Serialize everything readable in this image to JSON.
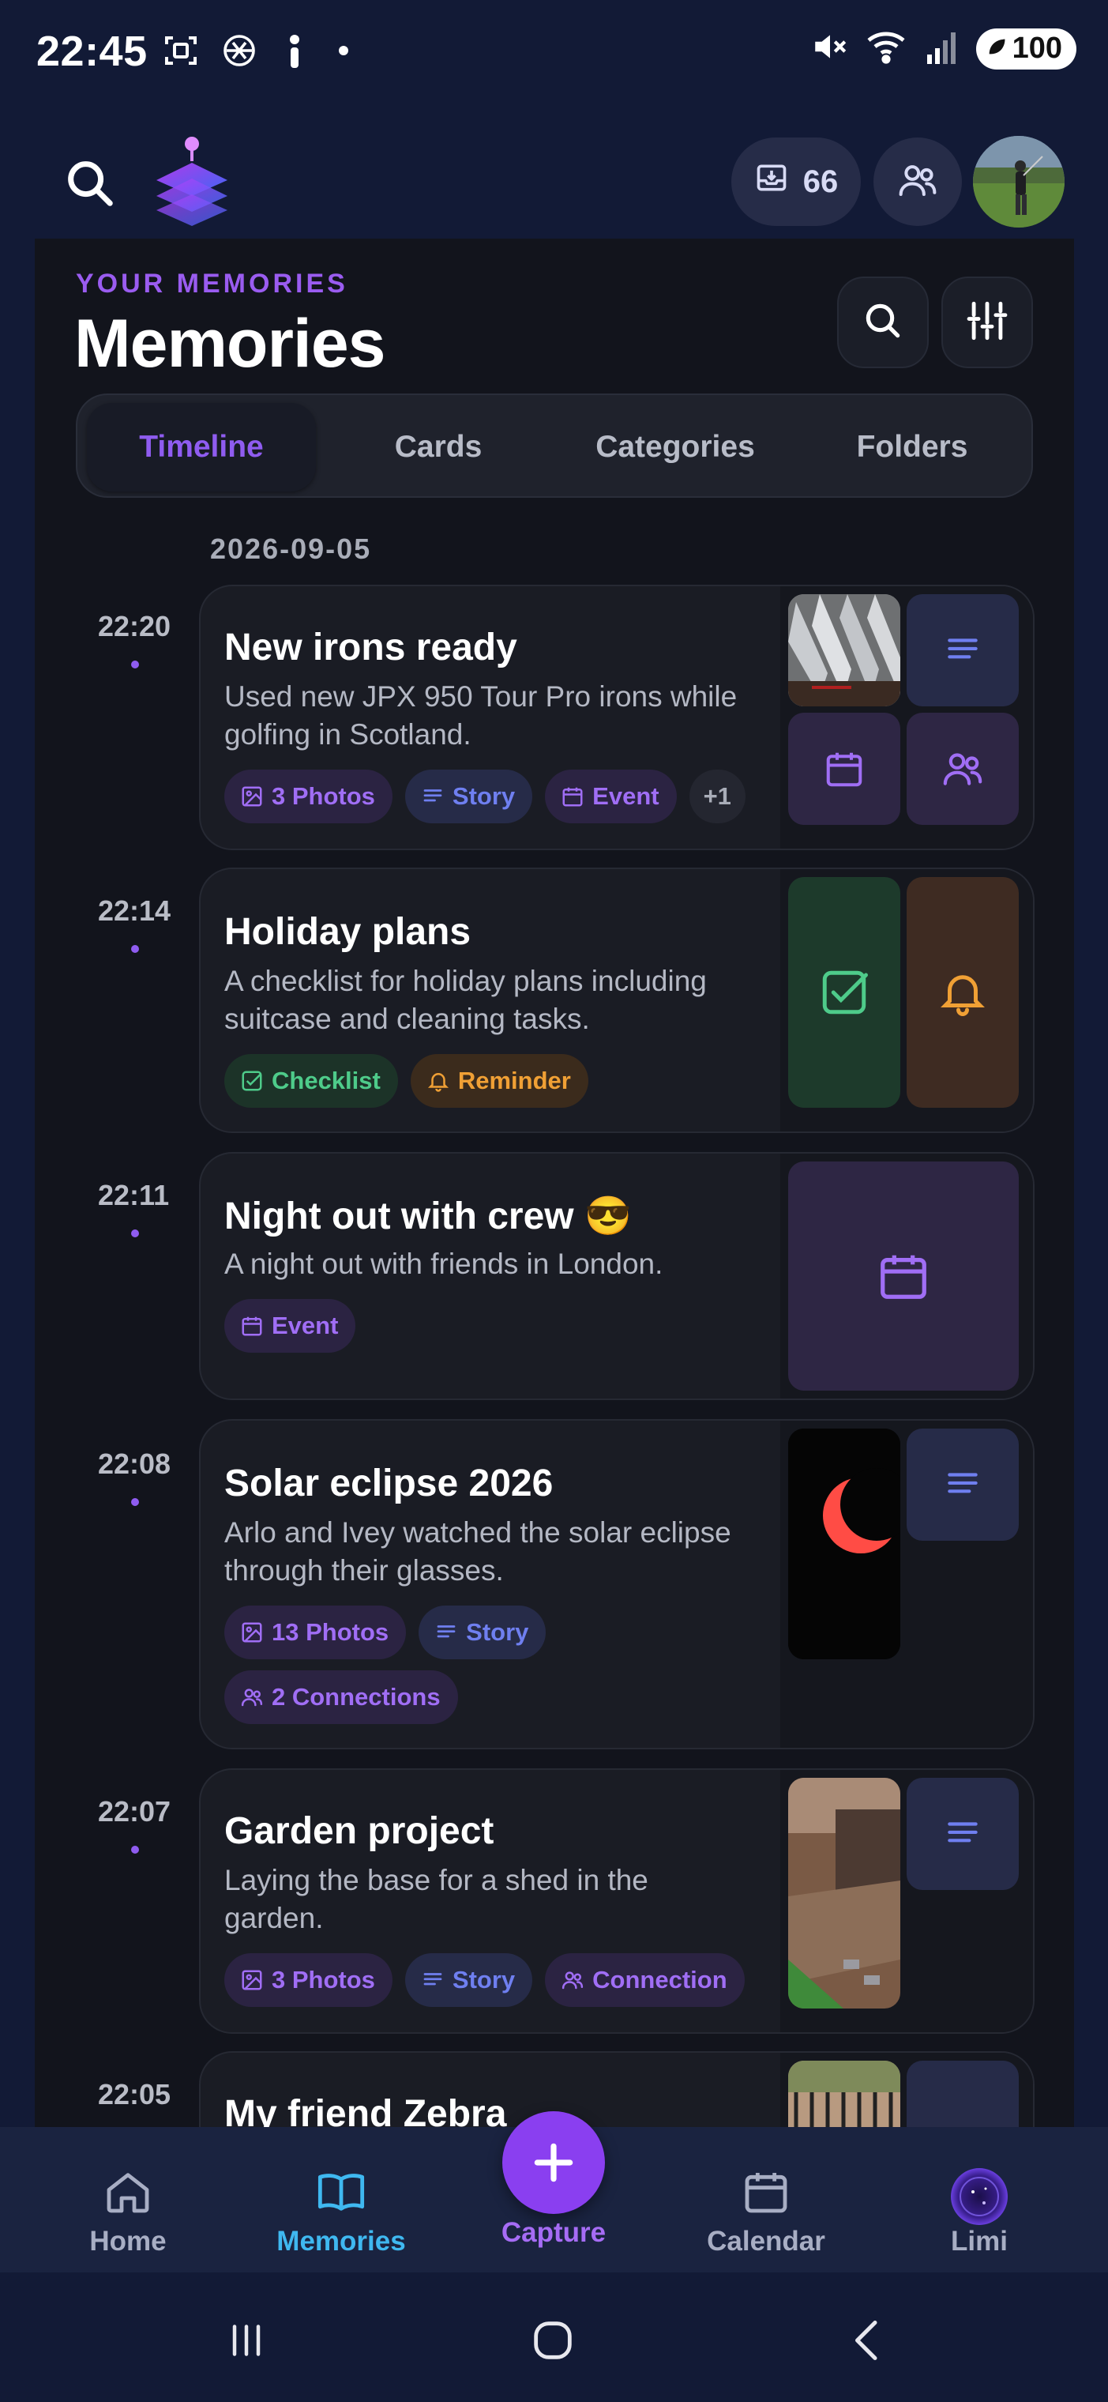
{
  "status_bar": {
    "time": "22:45",
    "battery": "100"
  },
  "header": {
    "archive_count": "66"
  },
  "page": {
    "eyebrow": "YOUR MEMORIES",
    "title": "Memories",
    "tabs": [
      {
        "label": "Timeline",
        "active": true
      },
      {
        "label": "Cards",
        "active": false
      },
      {
        "label": "Categories",
        "active": false
      },
      {
        "label": "Folders",
        "active": false
      }
    ]
  },
  "timeline": {
    "date": "2026-09-05",
    "entries": [
      {
        "time": "22:20",
        "title": "New irons ready",
        "description": "Used new JPX 950 Tour Pro irons while golfing in Scotland.",
        "chips": [
          {
            "label": "3 Photos",
            "icon": "image-icon"
          },
          {
            "label": "Story",
            "icon": "lines-icon"
          },
          {
            "label": "Event",
            "icon": "calendar-icon"
          },
          {
            "label": "+1",
            "icon": ""
          }
        ]
      },
      {
        "time": "22:14",
        "title": "Holiday plans",
        "description": "A checklist for holiday plans including suitcase and cleaning tasks.",
        "chips": [
          {
            "label": "Checklist",
            "icon": "checkbox-icon"
          },
          {
            "label": "Reminder",
            "icon": "bell-icon"
          }
        ]
      },
      {
        "time": "22:11",
        "title": "Night out with crew 😎",
        "description": "A night out with friends in London.",
        "chips": [
          {
            "label": "Event",
            "icon": "calendar-icon"
          }
        ]
      },
      {
        "time": "22:08",
        "title": "Solar eclipse 2026",
        "description": "Arlo and Ivey watched the solar eclipse through their glasses.",
        "chips": [
          {
            "label": "13 Photos",
            "icon": "image-icon"
          },
          {
            "label": "Story",
            "icon": "lines-icon"
          },
          {
            "label": "2 Connections",
            "icon": "people-icon"
          }
        ]
      },
      {
        "time": "22:07",
        "title": "Garden project",
        "description": "Laying the base for a shed in the garden.",
        "chips": [
          {
            "label": "3 Photos",
            "icon": "image-icon"
          },
          {
            "label": "Story",
            "icon": "lines-icon"
          },
          {
            "label": "Connection",
            "icon": "people-icon"
          }
        ]
      },
      {
        "time": "22:05",
        "title": "My friend Zebra",
        "description": "",
        "chips": []
      }
    ]
  },
  "bottom_nav": {
    "items": [
      {
        "label": "Home",
        "icon": "home-icon"
      },
      {
        "label": "Memories",
        "icon": "book-icon",
        "active": true
      },
      {
        "label": "Capture",
        "icon": "plus-icon"
      },
      {
        "label": "Calendar",
        "icon": "calendar-icon"
      },
      {
        "label": "Limi",
        "icon": "limi-orb-icon"
      }
    ]
  },
  "colors": {
    "accent_purple": "#8f5cf0",
    "active_nav_blue": "#3fb8f0",
    "capture_purple": "#8a3ff0",
    "background": "#121a36"
  }
}
